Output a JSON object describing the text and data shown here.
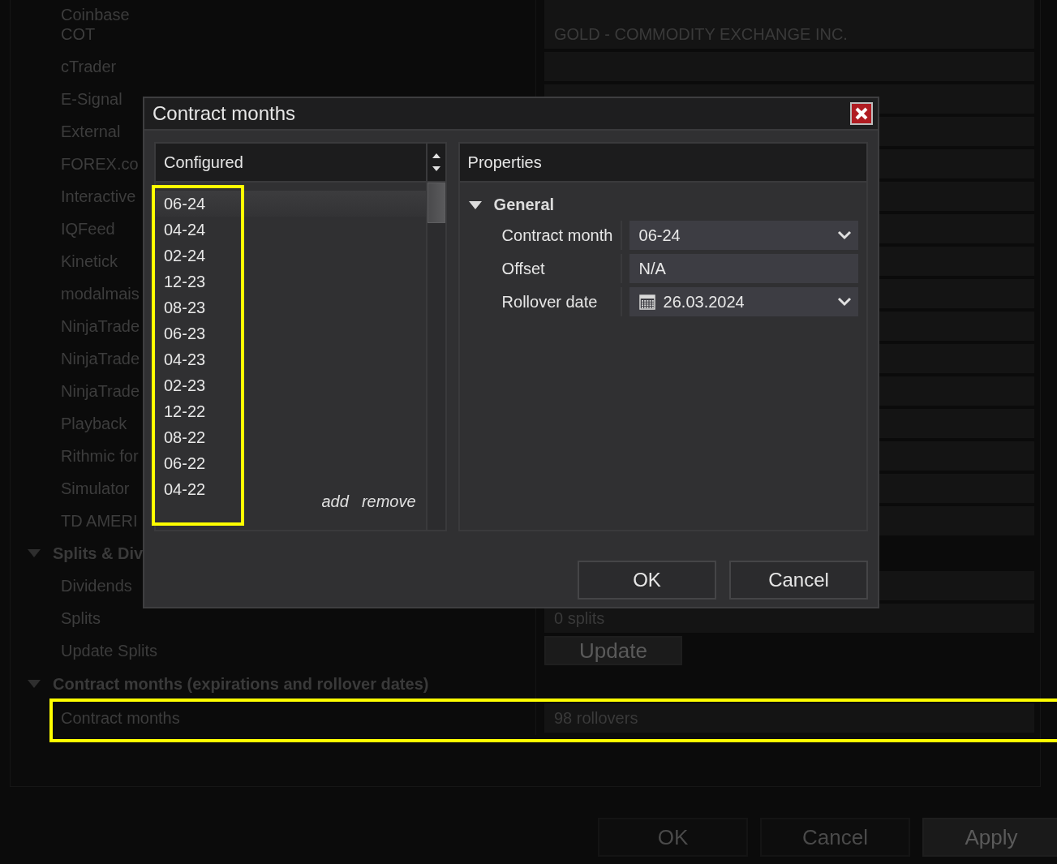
{
  "background": {
    "rows": [
      {
        "kind": "item",
        "label": "Coinbase",
        "highlighted": false,
        "field": {
          "kind": "field"
        }
      },
      {
        "kind": "item",
        "label": "COT",
        "highlighted": false,
        "field": {
          "kind": "field",
          "value": "GOLD - COMMODITY EXCHANGE INC."
        }
      },
      {
        "kind": "item",
        "label": "cTrader",
        "highlighted": false,
        "field": {
          "kind": "field"
        }
      },
      {
        "kind": "item",
        "label": "E-Signal",
        "highlighted": false,
        "field": {
          "kind": "field"
        }
      },
      {
        "kind": "item",
        "label": "External",
        "highlighted": false,
        "field": {
          "kind": "field"
        }
      },
      {
        "kind": "item",
        "label": "FOREX.co",
        "highlighted": false,
        "field": {
          "kind": "field"
        }
      },
      {
        "kind": "item",
        "label": "Interactive",
        "highlighted": false,
        "field": {
          "kind": "field"
        }
      },
      {
        "kind": "item",
        "label": "IQFeed",
        "highlighted": false,
        "field": {
          "kind": "field"
        }
      },
      {
        "kind": "item",
        "label": "Kinetick",
        "highlighted": false,
        "field": {
          "kind": "field"
        }
      },
      {
        "kind": "item",
        "label": "modalmais",
        "highlighted": false,
        "field": {
          "kind": "field"
        }
      },
      {
        "kind": "item",
        "label": "NinjaTrade",
        "highlighted": false,
        "field": {
          "kind": "field"
        }
      },
      {
        "kind": "item",
        "label": "NinjaTrade",
        "highlighted": false,
        "field": {
          "kind": "field"
        }
      },
      {
        "kind": "item",
        "label": "NinjaTrade",
        "highlighted": false,
        "field": {
          "kind": "field"
        }
      },
      {
        "kind": "item",
        "label": "Playback",
        "highlighted": false,
        "field": {
          "kind": "field"
        }
      },
      {
        "kind": "item",
        "label": "Rithmic for",
        "highlighted": false,
        "field": {
          "kind": "field"
        }
      },
      {
        "kind": "item",
        "label": "Simulator",
        "highlighted": false,
        "field": {
          "kind": "field"
        }
      },
      {
        "kind": "item",
        "label": "TD AMERI",
        "highlighted": false,
        "field": {
          "kind": "field"
        }
      },
      {
        "kind": "section",
        "label": "Splits & Div",
        "expanded": true
      },
      {
        "kind": "item",
        "label": "Dividends",
        "highlighted": false,
        "field": {
          "kind": "field"
        }
      },
      {
        "kind": "item",
        "label": "Splits",
        "highlighted": false,
        "field": {
          "kind": "field",
          "value": "0 splits"
        }
      },
      {
        "kind": "item",
        "label": "Update Splits",
        "highlighted": false,
        "field": {
          "kind": "button",
          "value": "Update"
        }
      },
      {
        "kind": "section",
        "label": "Contract months (expirations and rollover dates)",
        "expanded": true
      },
      {
        "kind": "item",
        "label": "Contract months",
        "highlighted": true,
        "field": {
          "kind": "field",
          "value": "98 rollovers"
        }
      }
    ]
  },
  "footer_buttons": [
    {
      "label": "OK",
      "kind": "normal"
    },
    {
      "label": "Cancel",
      "kind": "normal"
    },
    {
      "label": "Apply",
      "kind": "filled"
    }
  ],
  "dialog": {
    "title": "Contract months",
    "list": {
      "header": "Configured",
      "highlighted": true,
      "items": [
        {
          "label": "06-24",
          "selected": true
        },
        {
          "label": "04-24",
          "selected": false
        },
        {
          "label": "02-24",
          "selected": false
        },
        {
          "label": "12-23",
          "selected": false
        },
        {
          "label": "08-23",
          "selected": false
        },
        {
          "label": "06-23",
          "selected": false
        },
        {
          "label": "04-23",
          "selected": false
        },
        {
          "label": "02-23",
          "selected": false
        },
        {
          "label": "12-22",
          "selected": false
        },
        {
          "label": "08-22",
          "selected": false
        },
        {
          "label": "06-22",
          "selected": false
        },
        {
          "label": "04-22",
          "selected": false
        }
      ],
      "actions": [
        "add",
        "remove"
      ]
    },
    "properties": {
      "header": "Properties",
      "group": {
        "label": "General",
        "expanded": true
      },
      "rows": [
        {
          "label": "Contract month",
          "kind": "dropdown",
          "value": "06-24"
        },
        {
          "label": "Offset",
          "kind": "text",
          "value": "N/A"
        },
        {
          "label": "Rollover date",
          "kind": "date",
          "value": "26.03.2024"
        }
      ]
    },
    "buttons": [
      "OK",
      "Cancel"
    ]
  }
}
